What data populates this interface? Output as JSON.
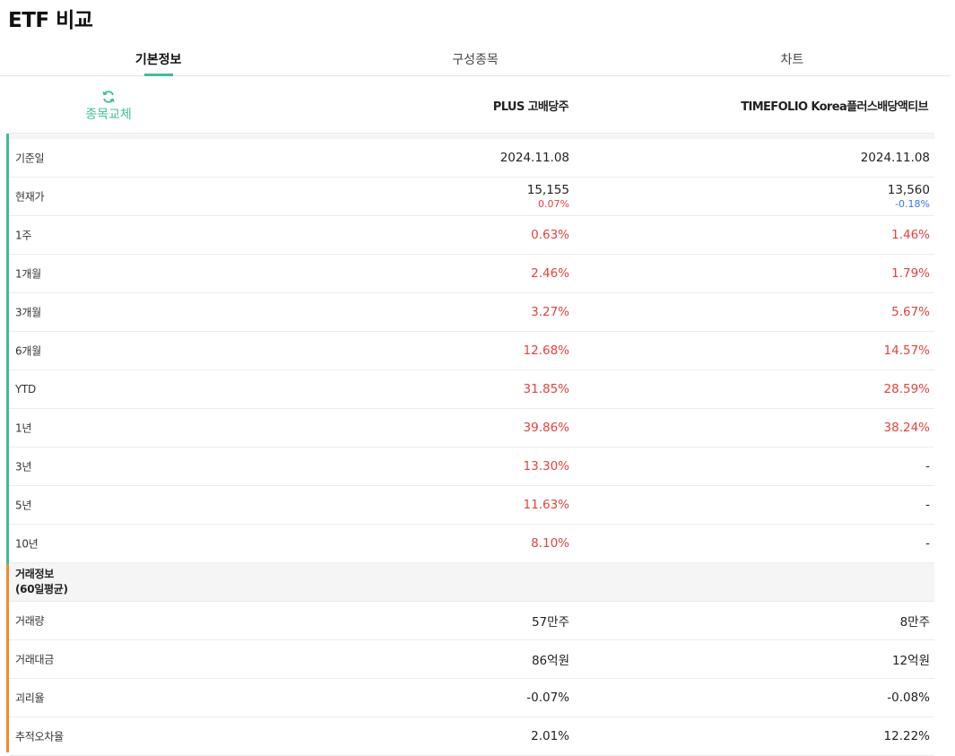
{
  "page": {
    "title": "ETF 비교"
  },
  "tabs": [
    "기본정보",
    "구성종목",
    "차트"
  ],
  "header": {
    "swap_label": "종목교체",
    "fund1": "PLUS 고배당주",
    "fund2": "TIMEFOLIO Korea플러스배당액티브"
  },
  "colors": {
    "accent": "#3dbf93",
    "section_trade": "#f08c2e",
    "up": "#e8413c",
    "down": "#3b73e0"
  },
  "rows": [
    {
      "label": "기준일",
      "v1": "2024.11.08",
      "v2": "2024.11.08"
    },
    {
      "label": "현재가",
      "v1": "15,155",
      "v1_change": "0.07%",
      "v2": "13,560",
      "v2_change": "-0.18%"
    },
    {
      "label": "1주",
      "v1": "0.63%",
      "v2": "1.46%"
    },
    {
      "label": "1개월",
      "v1": "2.46%",
      "v2": "1.79%"
    },
    {
      "label": "3개월",
      "v1": "3.27%",
      "v2": "5.67%"
    },
    {
      "label": "6개월",
      "v1": "12.68%",
      "v2": "14.57%"
    },
    {
      "label": "YTD",
      "v1": "31.85%",
      "v2": "28.59%"
    },
    {
      "label": "1년",
      "v1": "39.86%",
      "v2": "38.24%"
    },
    {
      "label": "3년",
      "v1": "13.30%",
      "v2": "-"
    },
    {
      "label": "5년",
      "v1": "11.63%",
      "v2": "-"
    },
    {
      "label": "10년",
      "v1": "8.10%",
      "v2": "-"
    }
  ],
  "trade_section": {
    "line1": "거래정보",
    "line2": "(60일평균)"
  },
  "trade_rows": [
    {
      "label": "거래량",
      "v1": "57만주",
      "v2": "8만주"
    },
    {
      "label": "거래대금",
      "v1": "86억원",
      "v2": "12억원"
    },
    {
      "label": "괴리율",
      "v1": "-0.07%",
      "v2": "-0.08%"
    },
    {
      "label": "추적오차율",
      "v1": "2.01%",
      "v2": "12.22%"
    }
  ]
}
